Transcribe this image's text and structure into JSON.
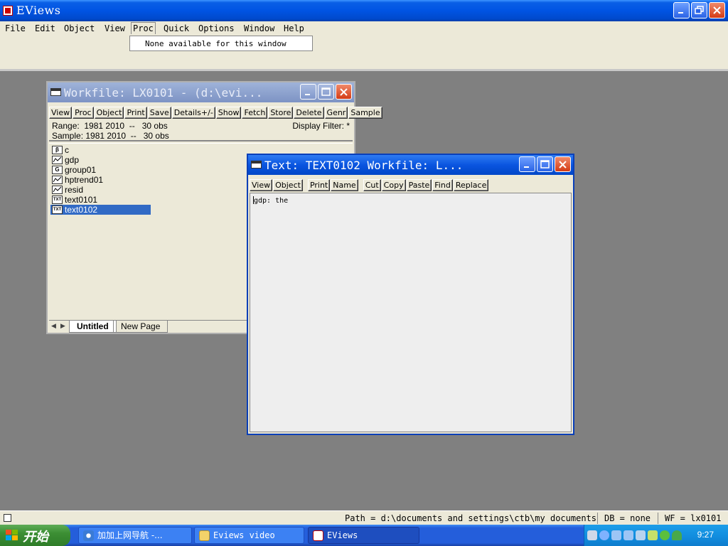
{
  "app": {
    "title": "EViews"
  },
  "menubar": {
    "items": [
      "File",
      "Edit",
      "Object",
      "View",
      "Proc",
      "Quick",
      "Options",
      "Window",
      "Help"
    ],
    "open_menu_message": "None available for this window"
  },
  "workfile_window": {
    "title": "Workfile: LX0101 - (d:\\evi...",
    "toolbar": [
      "View",
      "Proc",
      "Object",
      "Print",
      "Save",
      "Details+/-",
      "Show",
      "Fetch",
      "Store",
      "Delete",
      "Genr",
      "Sample"
    ],
    "range_text": "Range:  1981 2010  --   30 obs",
    "sample_text": "Sample: 1981 2010  --   30 obs",
    "display_filter": "Display Filter: *",
    "objects": [
      {
        "name": "c",
        "icon": "coef-icon"
      },
      {
        "name": "gdp",
        "icon": "series-icon"
      },
      {
        "name": "group01",
        "icon": "group-icon"
      },
      {
        "name": "hptrend01",
        "icon": "series-icon"
      },
      {
        "name": "resid",
        "icon": "series-icon"
      },
      {
        "name": "text0101",
        "icon": "text-icon"
      },
      {
        "name": "text0102",
        "icon": "text-icon"
      }
    ],
    "selected_object": "text0102",
    "tabs": [
      "Untitled",
      "New Page"
    ]
  },
  "text_window": {
    "title": "Text: TEXT0102   Workfile: L...",
    "toolbar": [
      "View",
      "Object",
      "Print",
      "Name",
      "Cut",
      "Copy",
      "Paste",
      "Find",
      "Replace"
    ],
    "content": "gdp: the"
  },
  "statusbar": {
    "path": "Path = d:\\documents and settings\\ctb\\my documents",
    "db": "DB = none",
    "wf": "WF = lx0101"
  },
  "taskbar": {
    "start_label": "开始",
    "tasks": [
      "加加上网导航 -...",
      "Eviews video",
      "EViews"
    ],
    "active_task": "EViews",
    "clock": "9:27"
  },
  "colors": {
    "titlebar": "#0054e3",
    "selection": "#316ac5",
    "start_green": "#3c8f34"
  }
}
